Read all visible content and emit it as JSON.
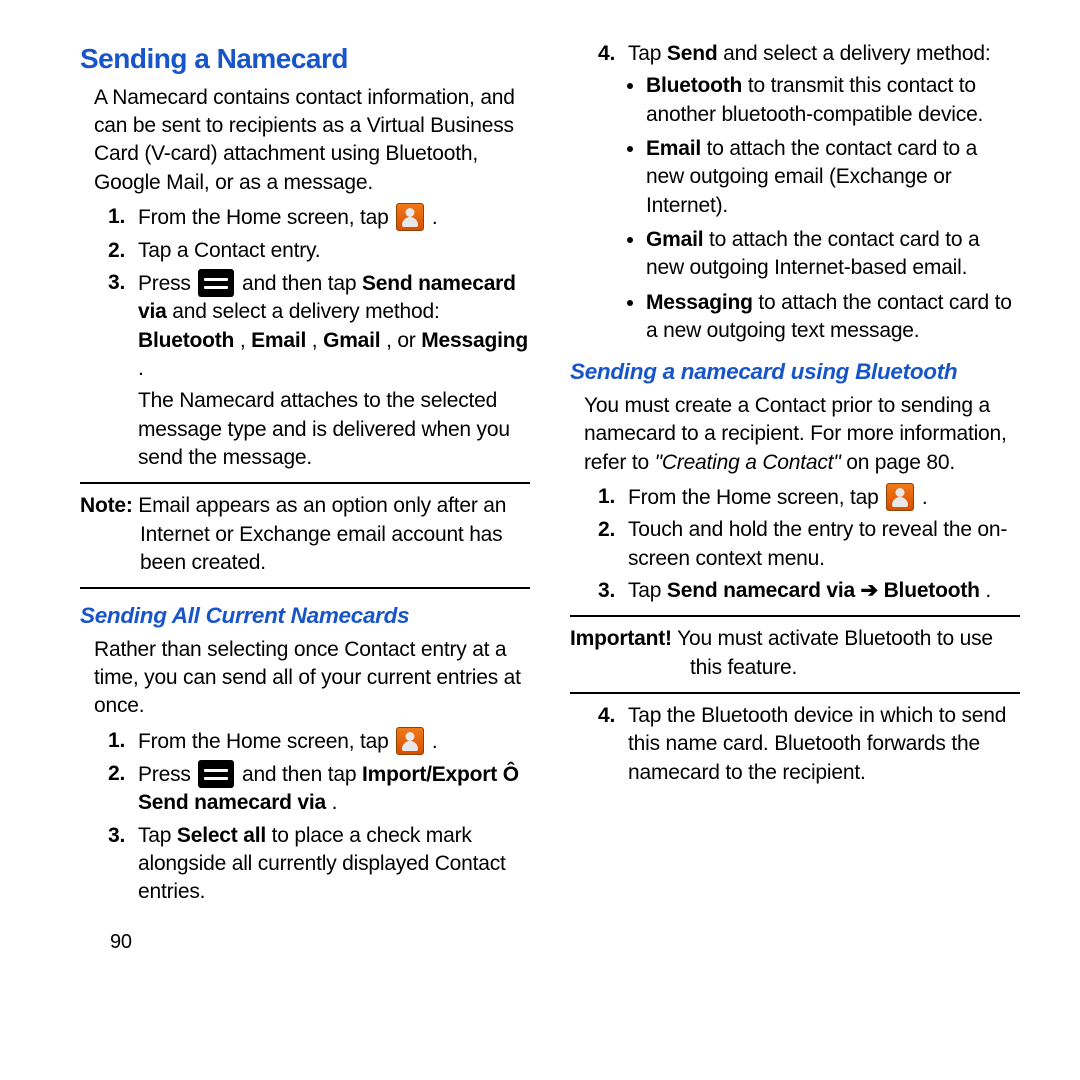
{
  "page_number": "90",
  "section1": {
    "title": "Sending a Namecard",
    "intro": "A Namecard contains contact information, and can be sent to recipients as a Virtual Business Card (V-card) attachment using Bluetooth, Google Mail, or as a message.",
    "s1n1": "1.",
    "s1t1a": "From the Home screen, tap ",
    "s1t1b": " .",
    "s1n2": "2.",
    "s1t2": "Tap a Contact entry.",
    "s1n3": "3.",
    "s1t3a": "Press ",
    "s1t3b": " and then tap ",
    "s1t3c": "Send namecard via",
    "s1t3d": " and select a delivery method: ",
    "s1t3e": "Bluetooth",
    "s1t3f": ", ",
    "s1t3g": "Email",
    "s1t3h": ", ",
    "s1t3i": "Gmail",
    "s1t3j": ", or ",
    "s1t3k": "Messaging",
    "s1t3l": ".",
    "s1t3m": "The Namecard attaches to the selected message type and is delivered when you send the message.",
    "note_label": "Note:",
    "note_text": " Email appears as an option only after an Internet or Exchange email account has been created."
  },
  "sub_all": {
    "title": "Sending All Current Namecards",
    "intro": "Rather than selecting once Contact entry at a time, you can send all of your current entries at once.",
    "n1": "1.",
    "t1a": "From the Home screen, tap ",
    "t1b": " .",
    "n2": "2.",
    "t2a": "Press ",
    "t2b": " and then tap ",
    "t2c": "Import/Export Ô Send namecard via",
    "t2d": ".",
    "n3": "3.",
    "t3a": "Tap ",
    "t3b": "Select all",
    "t3c": " to place a check mark alongside all currently displayed Contact entries."
  },
  "col2": {
    "n4": "4.",
    "t4a": "Tap ",
    "t4b": "Send",
    "t4c": " and select a delivery method:",
    "b1a": "Bluetooth",
    "b1b": " to transmit this contact to another bluetooth-compatible device.",
    "b2a": "Email",
    "b2b": " to attach the contact card to a new outgoing email (Exchange or Internet).",
    "b3a": "Gmail",
    "b3b": " to attach the contact card to a new outgoing Internet-based email.",
    "b4a": "Messaging",
    "b4b": " to attach the contact card to a new outgoing text message."
  },
  "sub_bt": {
    "title": "Sending a namecard using Bluetooth",
    "intro_a": "You must create a Contact prior to sending a namecard to a recipient. For more information, refer to ",
    "intro_b": "\"Creating a Contact\"",
    "intro_c": "  on page 80.",
    "n1": "1.",
    "t1a": "From the Home screen, tap ",
    "t1b": " .",
    "n2": "2.",
    "t2": "Touch and hold the entry to reveal the on-screen context menu.",
    "n3": "3.",
    "t3a": "Tap ",
    "t3b": "Send namecard via ➔ Bluetooth",
    "t3c": ".",
    "imp_label": "Important!",
    "imp_text": " You must activate Bluetooth to use this feature.",
    "n4": "4.",
    "t4": "Tap the Bluetooth device in which to send this name card. Bluetooth forwards the namecard to the recipient."
  }
}
